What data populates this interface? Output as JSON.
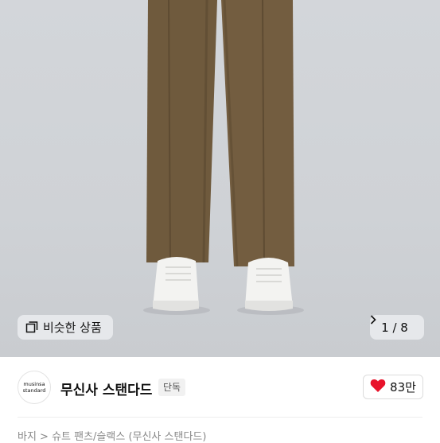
{
  "photo": {
    "similar_label": "비슷한 상품",
    "pager_label": "1 / 8",
    "colors": {
      "background": "#cfd2d6",
      "pants": "#6f5a3d",
      "shoes": "#f3f3f1"
    }
  },
  "brand": {
    "logo_line1": "musinsa",
    "logo_line2": "standard",
    "name": "무신사 스탠다드",
    "exclusive_badge": "단독",
    "likes": "83만",
    "like_color": "#e8132b"
  },
  "breadcrumb": "바지 > 슈트 팬츠/슬랙스 (무신사 스탠다드)"
}
